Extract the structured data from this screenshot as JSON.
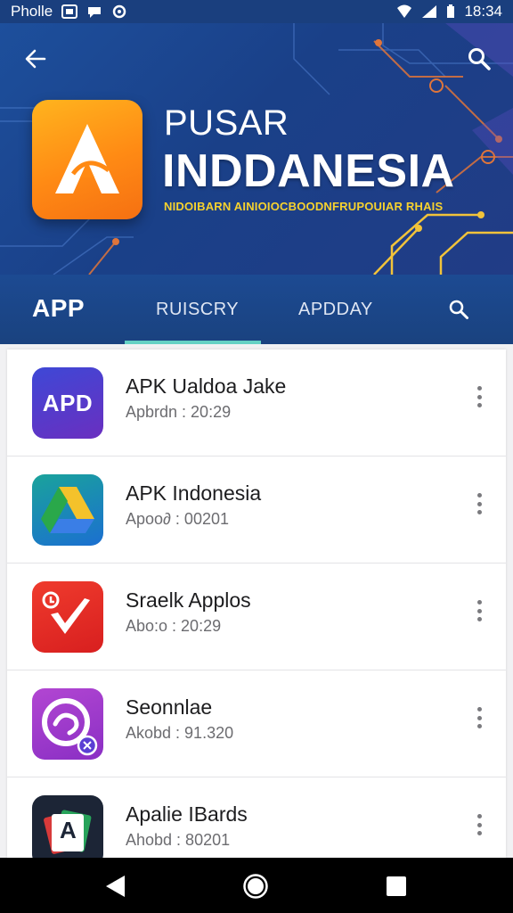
{
  "status_bar": {
    "left_text": "Pholle",
    "time": "18:34",
    "icons": [
      "image-icon",
      "message-icon",
      "sync-icon",
      "wifi-icon",
      "signal-icon",
      "battery-icon"
    ]
  },
  "header": {
    "back_icon": "back-arrow-icon",
    "search_icon": "search-icon",
    "title_line1": "PUSAR",
    "title_line2": "INDDANESIA",
    "subtitle": "NIDOIBARN AINIOIOCBOODNFRUPOUIAR RHAIS"
  },
  "tabs": {
    "brand": "APP",
    "items": [
      {
        "label": "RUISCRY",
        "active": true
      },
      {
        "label": "APDDAY",
        "active": false
      }
    ],
    "search_icon": "search-icon"
  },
  "apps": [
    {
      "name": "APK Ualdoa Jake",
      "meta": "Apbrdn : 20:29",
      "icon_text": "APD"
    },
    {
      "name": "APK Indonesia",
      "meta": "Apoo∂ : 00201",
      "icon_text": ""
    },
    {
      "name": "Sraelk Applos",
      "meta": "Abo:o : 20:29",
      "icon_text": ""
    },
    {
      "name": "Seonnlae",
      "meta": "Akobd : 91.320",
      "icon_text": ""
    },
    {
      "name": "Apalie IBards",
      "meta": "Ahobd : 80201",
      "icon_text": "A"
    }
  ],
  "nav_bar": {
    "icons": [
      "back-triangle-icon",
      "home-circle-icon",
      "recents-square-icon"
    ]
  },
  "colors": {
    "hero_blue": "#1a4088",
    "accent_teal": "#64d1c4",
    "hero_orange": "#ff8a14",
    "subtitle_yellow": "#f7d22e"
  }
}
